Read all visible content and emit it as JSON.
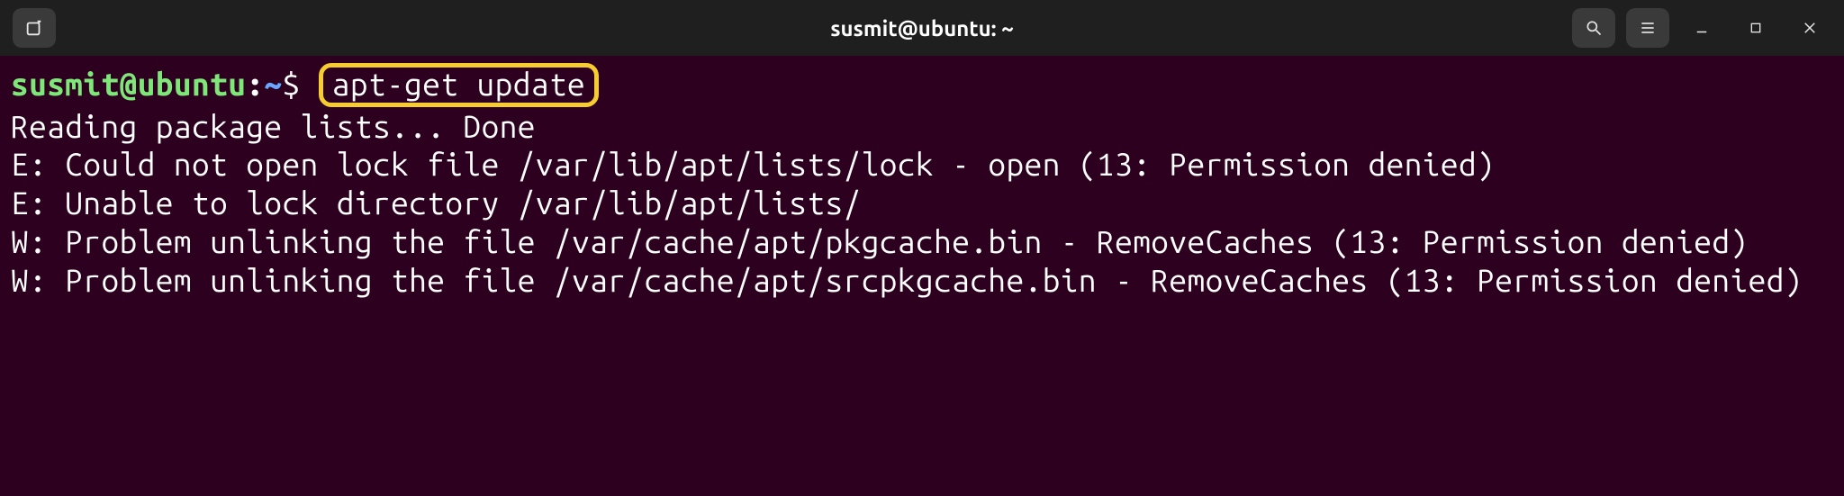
{
  "titlebar": {
    "title": "susmit@ubuntu: ~"
  },
  "prompt": {
    "user_host": "susmit@ubuntu",
    "separator": ":",
    "path": "~",
    "symbol": "$"
  },
  "command": "apt-get update",
  "output": {
    "line1": "Reading package lists... Done",
    "line2": "E: Could not open lock file /var/lib/apt/lists/lock - open (13: Permission denied)",
    "line3": "E: Unable to lock directory /var/lib/apt/lists/",
    "line4": "W: Problem unlinking the file /var/cache/apt/pkgcache.bin - RemoveCaches (13: Permission denied)",
    "line5": "W: Problem unlinking the file /var/cache/apt/srcpkgcache.bin - RemoveCaches (13: Permission denied)"
  }
}
